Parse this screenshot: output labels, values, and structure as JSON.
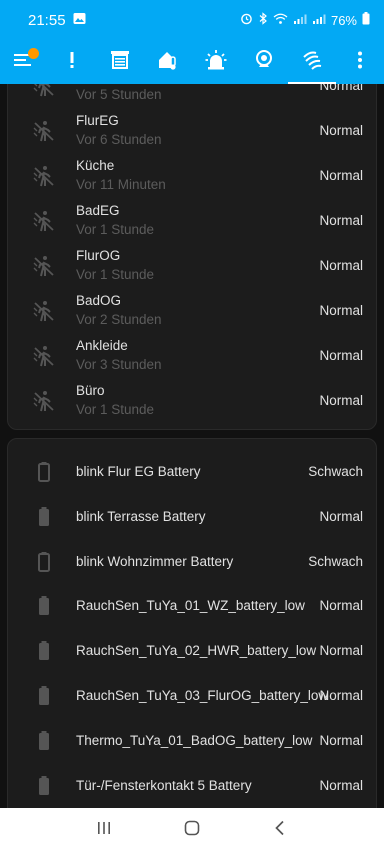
{
  "status": {
    "time": "21:55",
    "battery": "76%"
  },
  "toolbar": {
    "icons": [
      "menu-icon",
      "exclamation-icon",
      "gate-icon",
      "house-thermometer-icon",
      "siren-icon",
      "camera-icon",
      "motion-waves-icon",
      "more-vert-icon"
    ],
    "active_index": 6
  },
  "motion_sensors": [
    {
      "name": "",
      "sub": "Vor 5 Stunden",
      "state": "Normal"
    },
    {
      "name": "FlurEG",
      "sub": "Vor 6 Stunden",
      "state": "Normal"
    },
    {
      "name": "Küche",
      "sub": "Vor 11 Minuten",
      "state": "Normal"
    },
    {
      "name": "BadEG",
      "sub": "Vor 1 Stunde",
      "state": "Normal"
    },
    {
      "name": "FlurOG",
      "sub": "Vor 1 Stunde",
      "state": "Normal"
    },
    {
      "name": "BadOG",
      "sub": "Vor 2 Stunden",
      "state": "Normal"
    },
    {
      "name": "Ankleide",
      "sub": "Vor 3 Stunden",
      "state": "Normal"
    },
    {
      "name": "Büro",
      "sub": "Vor 1 Stunde",
      "state": "Normal"
    }
  ],
  "batteries": [
    {
      "name": "blink Flur EG Battery",
      "state": "Schwach",
      "icon": "battery-outline-icon"
    },
    {
      "name": "blink Terrasse Battery",
      "state": "Normal",
      "icon": "battery-full-icon"
    },
    {
      "name": "blink Wohnzimmer Battery",
      "state": "Schwach",
      "icon": "battery-outline-icon"
    },
    {
      "name": "RauchSen_TuYa_01_WZ_battery_low",
      "state": "Normal",
      "icon": "battery-full-icon"
    },
    {
      "name": "RauchSen_TuYa_02_HWR_battery_low",
      "state": "Normal",
      "icon": "battery-full-icon"
    },
    {
      "name": "RauchSen_TuYa_03_FlurOG_battery_low",
      "state": "Normal",
      "icon": "battery-full-icon"
    },
    {
      "name": "Thermo_TuYa_01_BadOG_battery_low",
      "state": "Normal",
      "icon": "battery-full-icon"
    },
    {
      "name": "Tür-/Fensterkontakt 5 Battery",
      "state": "Normal",
      "icon": "battery-full-icon"
    }
  ],
  "colors": {
    "accent": "#03a9f4",
    "badge": "#ff9800",
    "card": "#1c1c1c",
    "background": "#111111"
  }
}
